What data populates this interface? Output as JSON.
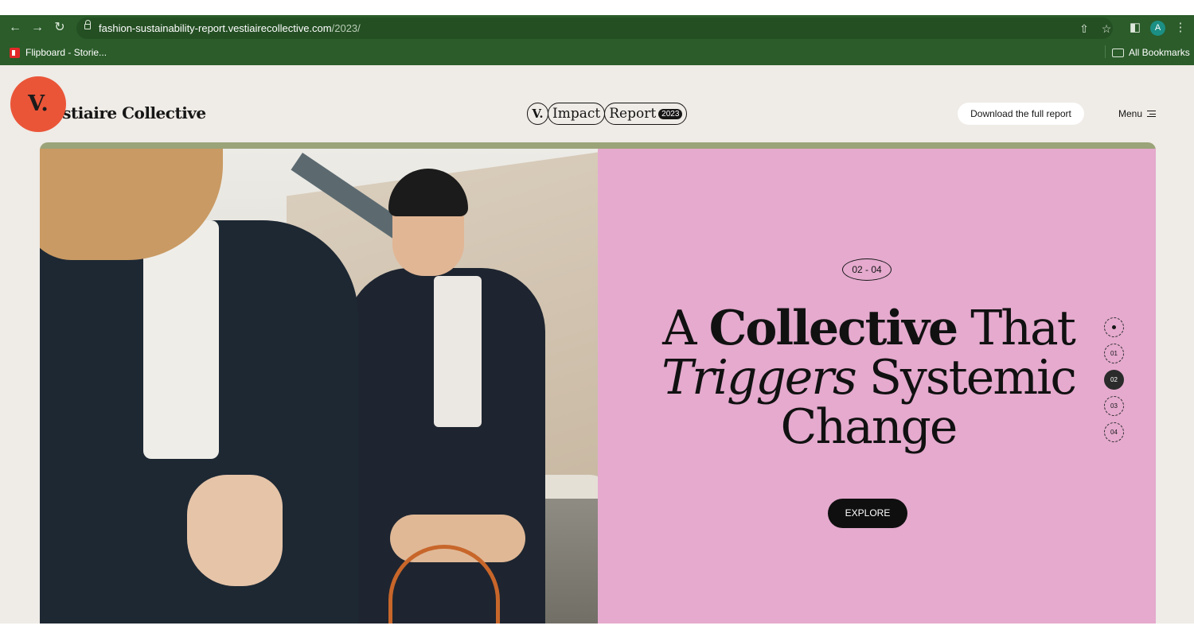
{
  "browser": {
    "url_host": "fashion-sustainability-report.vestiairecollective.com",
    "url_path": "/2023/",
    "profile_initial": "A",
    "bookmarks": [
      {
        "label": "Flipboard - Storie..."
      }
    ],
    "all_bookmarks_label": "All Bookmarks"
  },
  "header": {
    "logo_letter": "V.",
    "brand_text": "estiaire Collective",
    "impact_badge": {
      "v": "V.",
      "impact": "Impact",
      "report": "Report",
      "year": "2023"
    },
    "download_label": "Download the full report",
    "menu_label": "Menu"
  },
  "hero": {
    "counter": "02 - 04",
    "headline": {
      "w1": "A",
      "w2": "Collective",
      "w3": "That",
      "w4": "Triggers",
      "w5": "Systemic",
      "w6": "Change"
    },
    "explore_label": "EXPLORE",
    "slide_nav": [
      "01",
      "02",
      "03",
      "04"
    ],
    "active_slide": "02"
  },
  "colors": {
    "chrome": "#2b5c2a",
    "page_bg": "#efebe6",
    "logo": "#ea5538",
    "panel": "#e5aace",
    "hero_border": "#9ba378"
  }
}
